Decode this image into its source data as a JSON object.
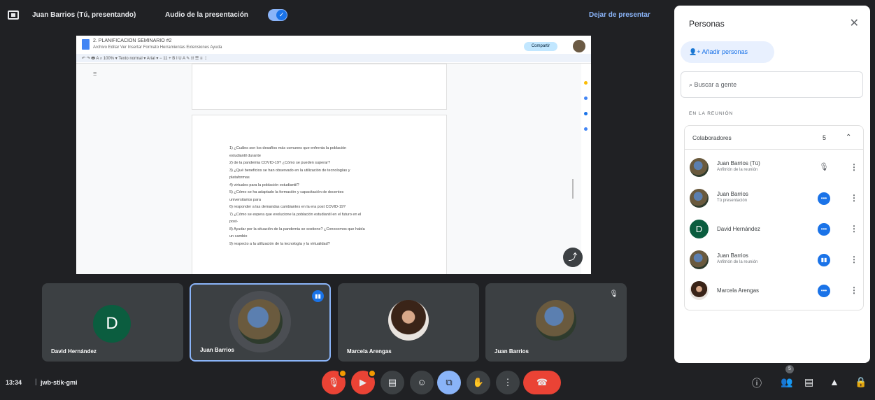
{
  "topbar": {
    "presenter": "Juan Barrios (Tú, presentando)",
    "audio_label": "Audio de la presentación",
    "stop_presenting": "Dejar de presentar"
  },
  "document": {
    "title": "2. PLANIFICACION SEMINARIO #2",
    "menu": "Archivo  Editar  Ver  Insertar  Formato  Herramientas  Extensiones  Ayuda",
    "share_label": "Compartir",
    "lines": [
      "1) ¿Cuáles son los desafíos más comunes que enfrenta la población",
      "   estudiantil durante",
      "2) de la pandemia COVID-19? ¿Cómo se pueden superar?",
      "3) ¿Qué beneficios se han observado en la utilización de tecnologías y",
      "   plataformas",
      "4) virtuales para la población estudiantil?",
      "5) ¿Cómo se ha adaptado la formación y capacitación de docentes",
      "   universitarios para",
      "6) responder a las demandas cambiantes en la era post COVID-19?",
      "7) ¿Cómo se espera que evolucione la población estudiantil en el futuro en el",
      "   post-",
      "8) Ayudar por la situación de la pandemia se sostiene? ¿Conocemos que había",
      "   un cambio",
      "9) respecto a la utilización de la tecnología y la virtualidad?"
    ]
  },
  "tiles": [
    {
      "name": "David Hernández",
      "initial": "D"
    },
    {
      "name": "Juan Barrios"
    },
    {
      "name": "Marcela Arengas"
    },
    {
      "name": "Juan Barrios"
    }
  ],
  "bottombar": {
    "time": "13:34",
    "meeting_code": "jwb-stik-gmi"
  },
  "panel": {
    "title": "Personas",
    "add_people": "Añadir personas",
    "search_placeholder": "Buscar a gente",
    "section": "EN LA REUNIÓN",
    "group_label": "Colaboradores",
    "group_count": "5",
    "people": [
      {
        "name": "Juan Barrios (Tú)",
        "sub": "Anfitrión de la reunión",
        "status": "mic-off"
      },
      {
        "name": "Juan Barrios",
        "sub": "Tú presentación",
        "status": "more-dots"
      },
      {
        "name": "David Hernández",
        "sub": "",
        "status": "more-dots",
        "initial": "D"
      },
      {
        "name": "Juan Barrios",
        "sub": "Anfitrión de la reunión",
        "status": "speaking"
      },
      {
        "name": "Marcela Arengas",
        "sub": "",
        "status": "more-dots"
      }
    ]
  },
  "colors": {
    "background": "#202124",
    "accent": "#1a73e8",
    "hangup": "#ea4335"
  }
}
